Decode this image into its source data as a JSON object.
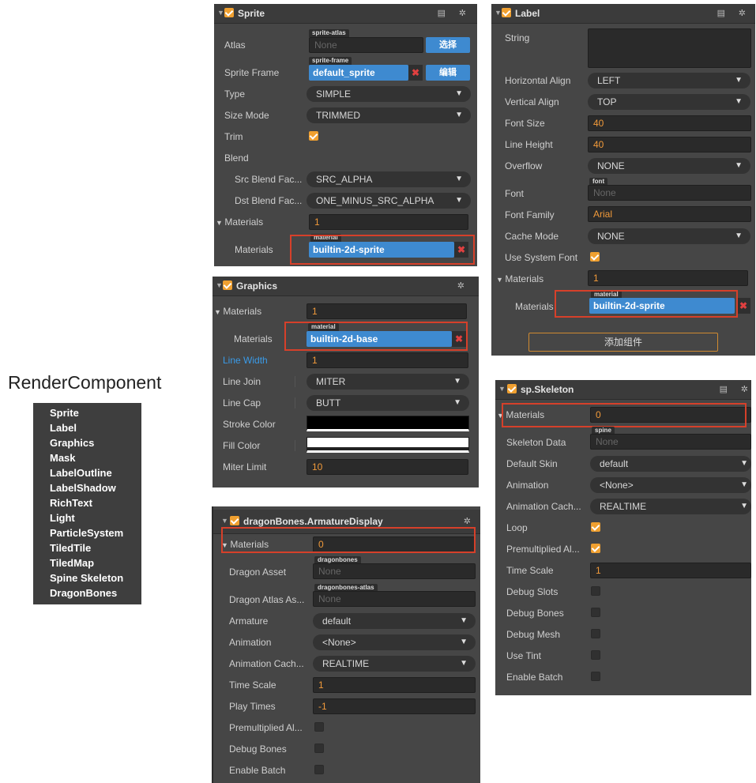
{
  "title": "RenderComponent",
  "menu": [
    "Sprite",
    "Label",
    "Graphics",
    "Mask",
    "LabelOutline",
    "LabelShadow",
    "RichText",
    "Light",
    "ParticleSystem",
    "TiledTile",
    "TiledMap",
    "Spine Skeleton",
    "DragonBones"
  ],
  "sprite": {
    "header": "Sprite",
    "atlas": {
      "label": "Atlas",
      "tag": "sprite-atlas",
      "value": "None",
      "button": "选择"
    },
    "sprite_frame": {
      "label": "Sprite Frame",
      "tag": "sprite-frame",
      "value": "default_sprite",
      "button": "编辑"
    },
    "type": {
      "label": "Type",
      "value": "SIMPLE"
    },
    "size_mode": {
      "label": "Size Mode",
      "value": "TRIMMED"
    },
    "trim": {
      "label": "Trim"
    },
    "blend": {
      "label": "Blend"
    },
    "src_blend": {
      "label": "Src Blend Fac...",
      "value": "SRC_ALPHA"
    },
    "dst_blend": {
      "label": "Dst Blend Fac...",
      "value": "ONE_MINUS_SRC_ALPHA"
    },
    "materials_count": {
      "label": "Materials",
      "value": "1"
    },
    "materials": {
      "label": "Materials",
      "tag": "material",
      "value": "builtin-2d-sprite"
    }
  },
  "graphics": {
    "header": "Graphics",
    "materials_count": {
      "label": "Materials",
      "value": "1"
    },
    "materials": {
      "label": "Materials",
      "tag": "material",
      "value": "builtin-2d-base"
    },
    "line_width": {
      "label": "Line Width",
      "value": "1"
    },
    "line_join": {
      "label": "Line Join",
      "value": "MITER"
    },
    "line_cap": {
      "label": "Line Cap",
      "value": "BUTT"
    },
    "stroke_color": {
      "label": "Stroke Color"
    },
    "fill_color": {
      "label": "Fill Color"
    },
    "miter_limit": {
      "label": "Miter Limit",
      "value": "10"
    }
  },
  "dragon": {
    "header": "dragonBones.ArmatureDisplay",
    "materials": {
      "label": "Materials",
      "value": "0"
    },
    "dragon_asset": {
      "label": "Dragon Asset",
      "tag": "dragonbones",
      "value": "None"
    },
    "dragon_atlas": {
      "label": "Dragon Atlas As...",
      "tag": "dragonbones-atlas",
      "value": "None"
    },
    "armature": {
      "label": "Armature",
      "value": "default"
    },
    "animation": {
      "label": "Animation",
      "value": "<None>"
    },
    "animation_cache": {
      "label": "Animation Cach...",
      "value": "REALTIME"
    },
    "time_scale": {
      "label": "Time Scale",
      "value": "1"
    },
    "play_times": {
      "label": "Play Times",
      "value": "-1"
    },
    "premultiplied": {
      "label": "Premultiplied Al..."
    },
    "debug_bones": {
      "label": "Debug Bones"
    },
    "enable_batch": {
      "label": "Enable Batch"
    }
  },
  "label": {
    "header": "Label",
    "string": {
      "label": "String"
    },
    "h_align": {
      "label": "Horizontal Align",
      "value": "LEFT"
    },
    "v_align": {
      "label": "Vertical Align",
      "value": "TOP"
    },
    "font_size": {
      "label": "Font Size",
      "value": "40"
    },
    "line_height": {
      "label": "Line Height",
      "value": "40"
    },
    "overflow": {
      "label": "Overflow",
      "value": "NONE"
    },
    "font": {
      "label": "Font",
      "tag": "font",
      "value": "None"
    },
    "font_family": {
      "label": "Font Family",
      "value": "Arial"
    },
    "cache_mode": {
      "label": "Cache Mode",
      "value": "NONE"
    },
    "use_system_font": {
      "label": "Use System Font"
    },
    "materials_count": {
      "label": "Materials",
      "value": "1"
    },
    "materials": {
      "label": "Materials",
      "tag": "material",
      "value": "builtin-2d-sprite"
    },
    "add_component": "添加组件"
  },
  "skeleton": {
    "header": "sp.Skeleton",
    "materials": {
      "label": "Materials",
      "value": "0"
    },
    "skeleton_data": {
      "label": "Skeleton Data",
      "tag": "spine",
      "value": "None"
    },
    "default_skin": {
      "label": "Default Skin",
      "value": "default"
    },
    "animation": {
      "label": "Animation",
      "value": "<None>"
    },
    "animation_cache": {
      "label": "Animation Cach...",
      "value": "REALTIME"
    },
    "loop": {
      "label": "Loop"
    },
    "premultiplied": {
      "label": "Premultiplied Al..."
    },
    "time_scale": {
      "label": "Time Scale",
      "value": "1"
    },
    "debug_slots": {
      "label": "Debug Slots"
    },
    "debug_bones": {
      "label": "Debug Bones"
    },
    "debug_mesh": {
      "label": "Debug Mesh"
    },
    "use_tint": {
      "label": "Use Tint"
    },
    "enable_batch": {
      "label": "Enable Batch"
    }
  },
  "icons": {
    "doc": "book-icon",
    "gear": "gear-icon",
    "arrow": "collapse-arrow-icon",
    "external": "external-link-icon"
  },
  "colors": {
    "accent": "#3e8ad0",
    "highlight": "#d6402a",
    "value": "#f19a3a",
    "panel": "#464646"
  }
}
